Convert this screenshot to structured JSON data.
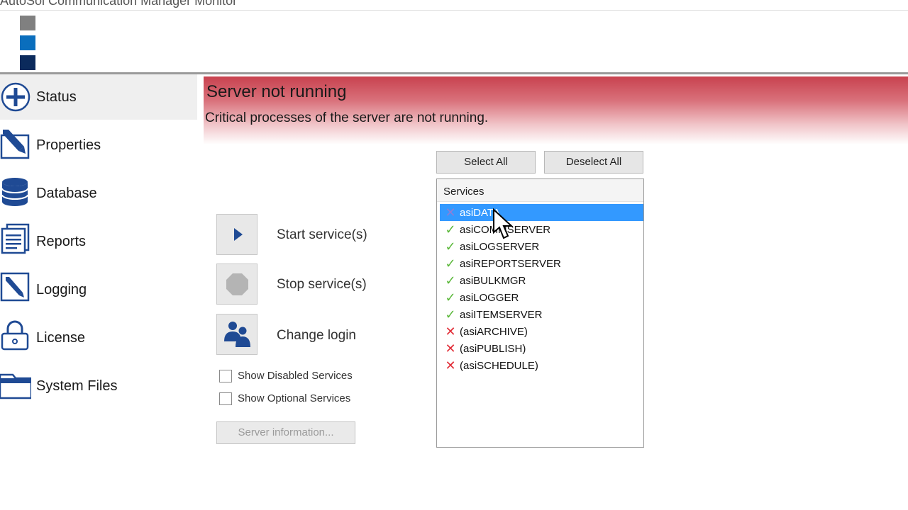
{
  "window": {
    "title": "AutoSol Communication Manager Monitor"
  },
  "colors": {
    "banner_red": "#c8424f",
    "select_blue": "#3399ff",
    "ok_green": "#5bb83a",
    "error_red": "#e2303a",
    "icon_blue": "#1f4a94"
  },
  "sidebar": {
    "items": [
      {
        "label": "Status",
        "icon": "plus-circle-icon",
        "active": true
      },
      {
        "label": "Properties",
        "icon": "pencil-edit-icon"
      },
      {
        "label": "Database",
        "icon": "database-icon"
      },
      {
        "label": "Reports",
        "icon": "report-document-icon"
      },
      {
        "label": "Logging",
        "icon": "log-pen-icon"
      },
      {
        "label": "License",
        "icon": "padlock-icon"
      },
      {
        "label": "System Files",
        "icon": "folder-icon"
      }
    ]
  },
  "banner": {
    "title": "Server not running",
    "subtitle": "Critical processes of the server are not running."
  },
  "actions": {
    "start": {
      "label": "Start service(s)",
      "icon": "play-icon"
    },
    "stop": {
      "label": "Stop service(s)",
      "icon": "stop-octagon-icon"
    },
    "login": {
      "label": "Change login",
      "icon": "users-icon"
    }
  },
  "options": {
    "show_disabled": {
      "label": "Show Disabled Services",
      "checked": false
    },
    "show_optional": {
      "label": "Show Optional Services",
      "checked": false
    }
  },
  "server_info_label": "Server information...",
  "select_all_label": "Select All",
  "deselect_all_label": "Deselect All",
  "services": {
    "header": "Services",
    "items": [
      {
        "name": "asiDATA",
        "status": "stopped",
        "selected": true
      },
      {
        "name": "asiCOMMSERVER",
        "status": "running"
      },
      {
        "name": "asiLOGSERVER",
        "status": "running"
      },
      {
        "name": "asiREPORTSERVER",
        "status": "running"
      },
      {
        "name": "asiBULKMGR",
        "status": "running"
      },
      {
        "name": "asiLOGGER",
        "status": "running"
      },
      {
        "name": "asiITEMSERVER",
        "status": "running"
      },
      {
        "name": "(asiARCHIVE)",
        "status": "stopped"
      },
      {
        "name": "(asiPUBLISH)",
        "status": "stopped"
      },
      {
        "name": "(asiSCHEDULE)",
        "status": "stopped"
      }
    ]
  }
}
